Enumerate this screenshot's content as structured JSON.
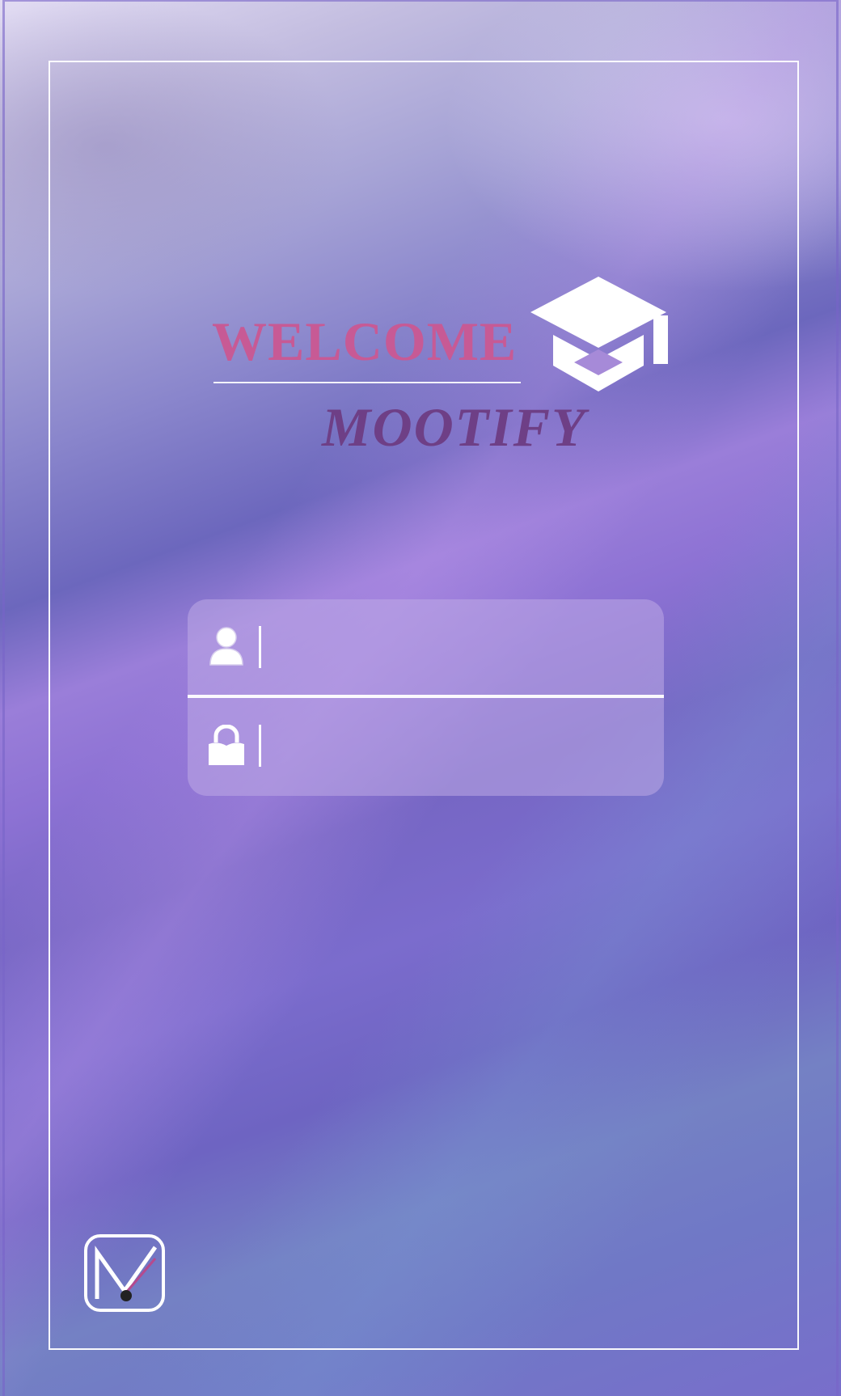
{
  "header": {
    "welcome_text": "WELCOME",
    "brand_name": "MOOTIFY"
  },
  "login": {
    "username": {
      "value": "",
      "placeholder": ""
    },
    "password": {
      "value": "",
      "placeholder": ""
    }
  },
  "icons": {
    "header": "graduation-cap-icon",
    "username": "user-icon",
    "password": "lock-icon",
    "app_logo": "mootify-logo"
  },
  "colors": {
    "welcome": "#c75a95",
    "brand": "#6e3f86",
    "frame": "#ffffff"
  }
}
